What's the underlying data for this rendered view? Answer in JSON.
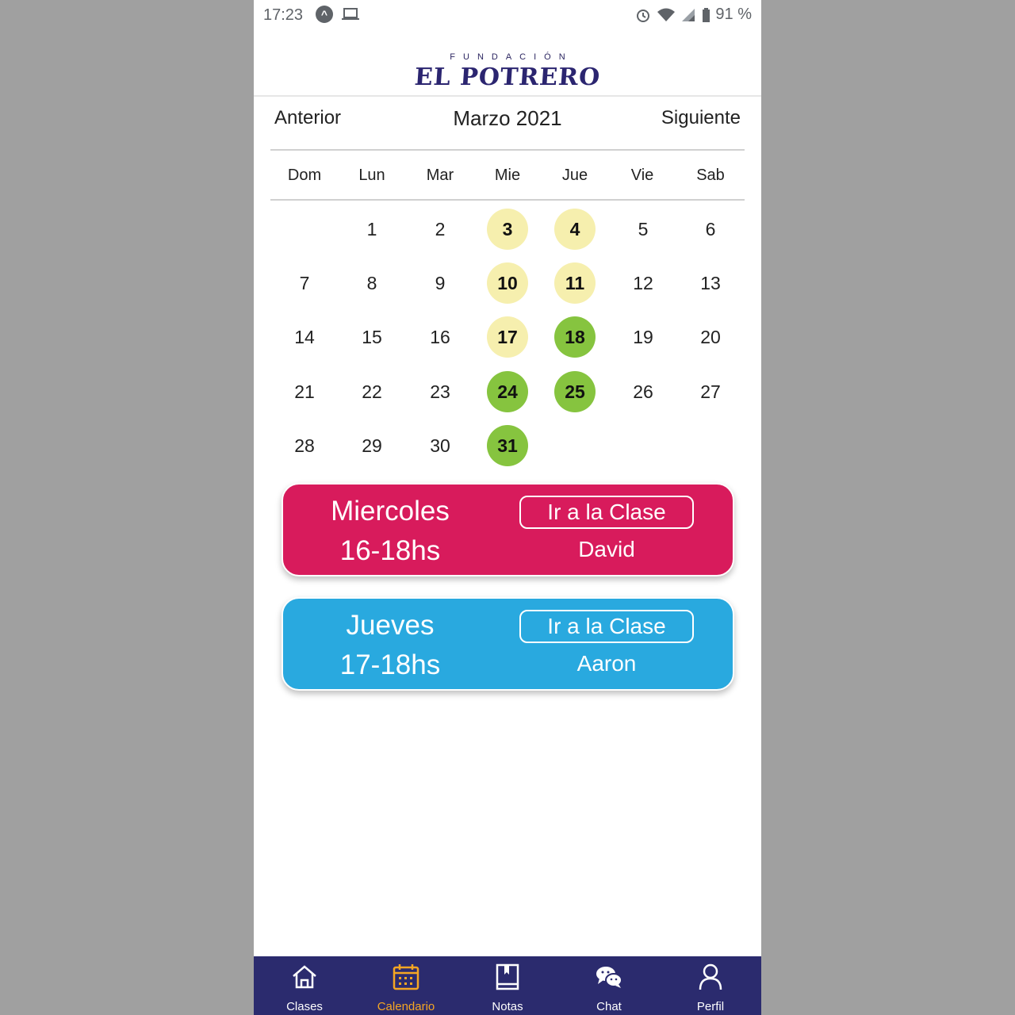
{
  "status_bar": {
    "time": "17:23",
    "battery": "91 %"
  },
  "logo": {
    "top": "FUNDACIÓN",
    "main": "EL POTRERO"
  },
  "month_nav": {
    "prev": "Anterior",
    "title": "Marzo 2021",
    "next": "Siguiente"
  },
  "weekdays": [
    "Dom",
    "Lun",
    "Mar",
    "Mie",
    "Jue",
    "Vie",
    "Sab"
  ],
  "days": [
    {
      "label": "1",
      "col": 1,
      "row": 0,
      "style": ""
    },
    {
      "label": "2",
      "col": 2,
      "row": 0,
      "style": ""
    },
    {
      "label": "3",
      "col": 3,
      "row": 0,
      "style": "yellow"
    },
    {
      "label": "4",
      "col": 4,
      "row": 0,
      "style": "yellow"
    },
    {
      "label": "5",
      "col": 5,
      "row": 0,
      "style": ""
    },
    {
      "label": "6",
      "col": 6,
      "row": 0,
      "style": ""
    },
    {
      "label": "7",
      "col": 0,
      "row": 1,
      "style": ""
    },
    {
      "label": "8",
      "col": 1,
      "row": 1,
      "style": ""
    },
    {
      "label": "9",
      "col": 2,
      "row": 1,
      "style": ""
    },
    {
      "label": "10",
      "col": 3,
      "row": 1,
      "style": "yellow"
    },
    {
      "label": "11",
      "col": 4,
      "row": 1,
      "style": "yellow"
    },
    {
      "label": "12",
      "col": 5,
      "row": 1,
      "style": ""
    },
    {
      "label": "13",
      "col": 6,
      "row": 1,
      "style": ""
    },
    {
      "label": "14",
      "col": 0,
      "row": 2,
      "style": ""
    },
    {
      "label": "15",
      "col": 1,
      "row": 2,
      "style": ""
    },
    {
      "label": "16",
      "col": 2,
      "row": 2,
      "style": ""
    },
    {
      "label": "17",
      "col": 3,
      "row": 2,
      "style": "yellow"
    },
    {
      "label": "18",
      "col": 4,
      "row": 2,
      "style": "green"
    },
    {
      "label": "19",
      "col": 5,
      "row": 2,
      "style": ""
    },
    {
      "label": "20",
      "col": 6,
      "row": 2,
      "style": ""
    },
    {
      "label": "21",
      "col": 0,
      "row": 3,
      "style": ""
    },
    {
      "label": "22",
      "col": 1,
      "row": 3,
      "style": ""
    },
    {
      "label": "23",
      "col": 2,
      "row": 3,
      "style": ""
    },
    {
      "label": "24",
      "col": 3,
      "row": 3,
      "style": "green"
    },
    {
      "label": "25",
      "col": 4,
      "row": 3,
      "style": "green"
    },
    {
      "label": "26",
      "col": 5,
      "row": 3,
      "style": ""
    },
    {
      "label": "27",
      "col": 6,
      "row": 3,
      "style": ""
    },
    {
      "label": "28",
      "col": 0,
      "row": 4,
      "style": ""
    },
    {
      "label": "29",
      "col": 1,
      "row": 4,
      "style": ""
    },
    {
      "label": "30",
      "col": 2,
      "row": 4,
      "style": ""
    },
    {
      "label": "31",
      "col": 3,
      "row": 4,
      "style": "green"
    }
  ],
  "classes": [
    {
      "day": "Miercoles",
      "time": "16-18hs",
      "button": "Ir a la Clase",
      "teacher": "David",
      "color": "#d81b5c"
    },
    {
      "day": "Jueves",
      "time": "17-18hs",
      "button": "Ir a la Clase",
      "teacher": "Aaron",
      "color": "#29a9df"
    }
  ],
  "bottom_nav": [
    {
      "label": "Clases",
      "icon": "home-icon",
      "active": false
    },
    {
      "label": "Calendario",
      "icon": "calendar-icon",
      "active": true
    },
    {
      "label": "Notas",
      "icon": "notebook-icon",
      "active": false
    },
    {
      "label": "Chat",
      "icon": "chat-icon",
      "active": false
    },
    {
      "label": "Perfil",
      "icon": "profile-icon",
      "active": false
    }
  ],
  "colors": {
    "accent_active": "#f5a623",
    "nav_bg": "#2b2b6e",
    "yellow_day": "#f6efae",
    "green_day": "#86c43f"
  }
}
